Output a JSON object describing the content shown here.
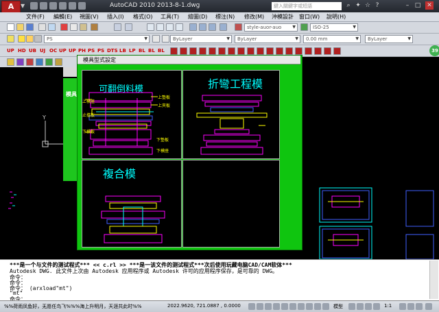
{
  "titlebar": {
    "app_icon": "A",
    "title": "AutoCAD 2010    2013-8-1.dwg",
    "search_placeholder": "鍵入關鍵字或短語"
  },
  "menu": [
    "文件(F)",
    "編輯(E)",
    "視圖(V)",
    "插入(I)",
    "格式(O)",
    "工具(T)",
    "繪圖(D)",
    "標注(N)",
    "修改(M)",
    "沖模設計",
    "窗口(W)",
    "說明(H)"
  ],
  "toolbar1": {
    "text_style": "style-auor-auo",
    "dim_style": "ISO-25"
  },
  "toolbar2": {
    "layer": "PS",
    "color": "ByLayer",
    "linetype": "ByLayer",
    "lineweight": "0.00 mm",
    "plotstyle": "ByLayer"
  },
  "toolbar3": {
    "labels": [
      "UP",
      "HD",
      "UB",
      "UJ",
      "OC",
      "UP",
      "UP",
      "PH",
      "PS",
      "PS",
      "DTS",
      "LB",
      "LP",
      "BL",
      "BL",
      "BL"
    ]
  },
  "side_panel": {
    "title": "模具"
  },
  "dialog": {
    "title": "模具型式設定",
    "q1_label": "可翻倒料模",
    "q2_label": "折彎工程模",
    "q3_label": "複合模",
    "q1_tags": [
      "上墊板",
      "上夾板",
      "上模座",
      "止擋板",
      "下模板",
      "下墊板",
      "下模座"
    ]
  },
  "command": {
    "lines": [
      "***是一个与文件的测试程式*** << c.rl >> ***是一该文件的测试程式***次后使用玩藏电脑CAD/CAM软体***",
      "Autodesk DWG.   此文件上次由 Autodesk 应用程序或 Autodesk 许可的应用程序保存，是可靠的 DWG。",
      "命令：",
      "命令：",
      "命令： (arxload\"mt\")",
      "\"mt\"",
      "命令："
    ]
  },
  "status": {
    "left_text": "%%荷雨凤鱼好，无愿任鸟飞%%%海上升明月，天涯共此时%%",
    "coords": "2022.9620, 721.0887 , 0.0000",
    "model": "模型",
    "scale": "1:1"
  },
  "badge": "39",
  "colors": {
    "accent_green": "#10c010",
    "cad_magenta": "#ff00ff",
    "cad_cyan": "#00ffff",
    "cad_yellow": "#ffff00"
  }
}
